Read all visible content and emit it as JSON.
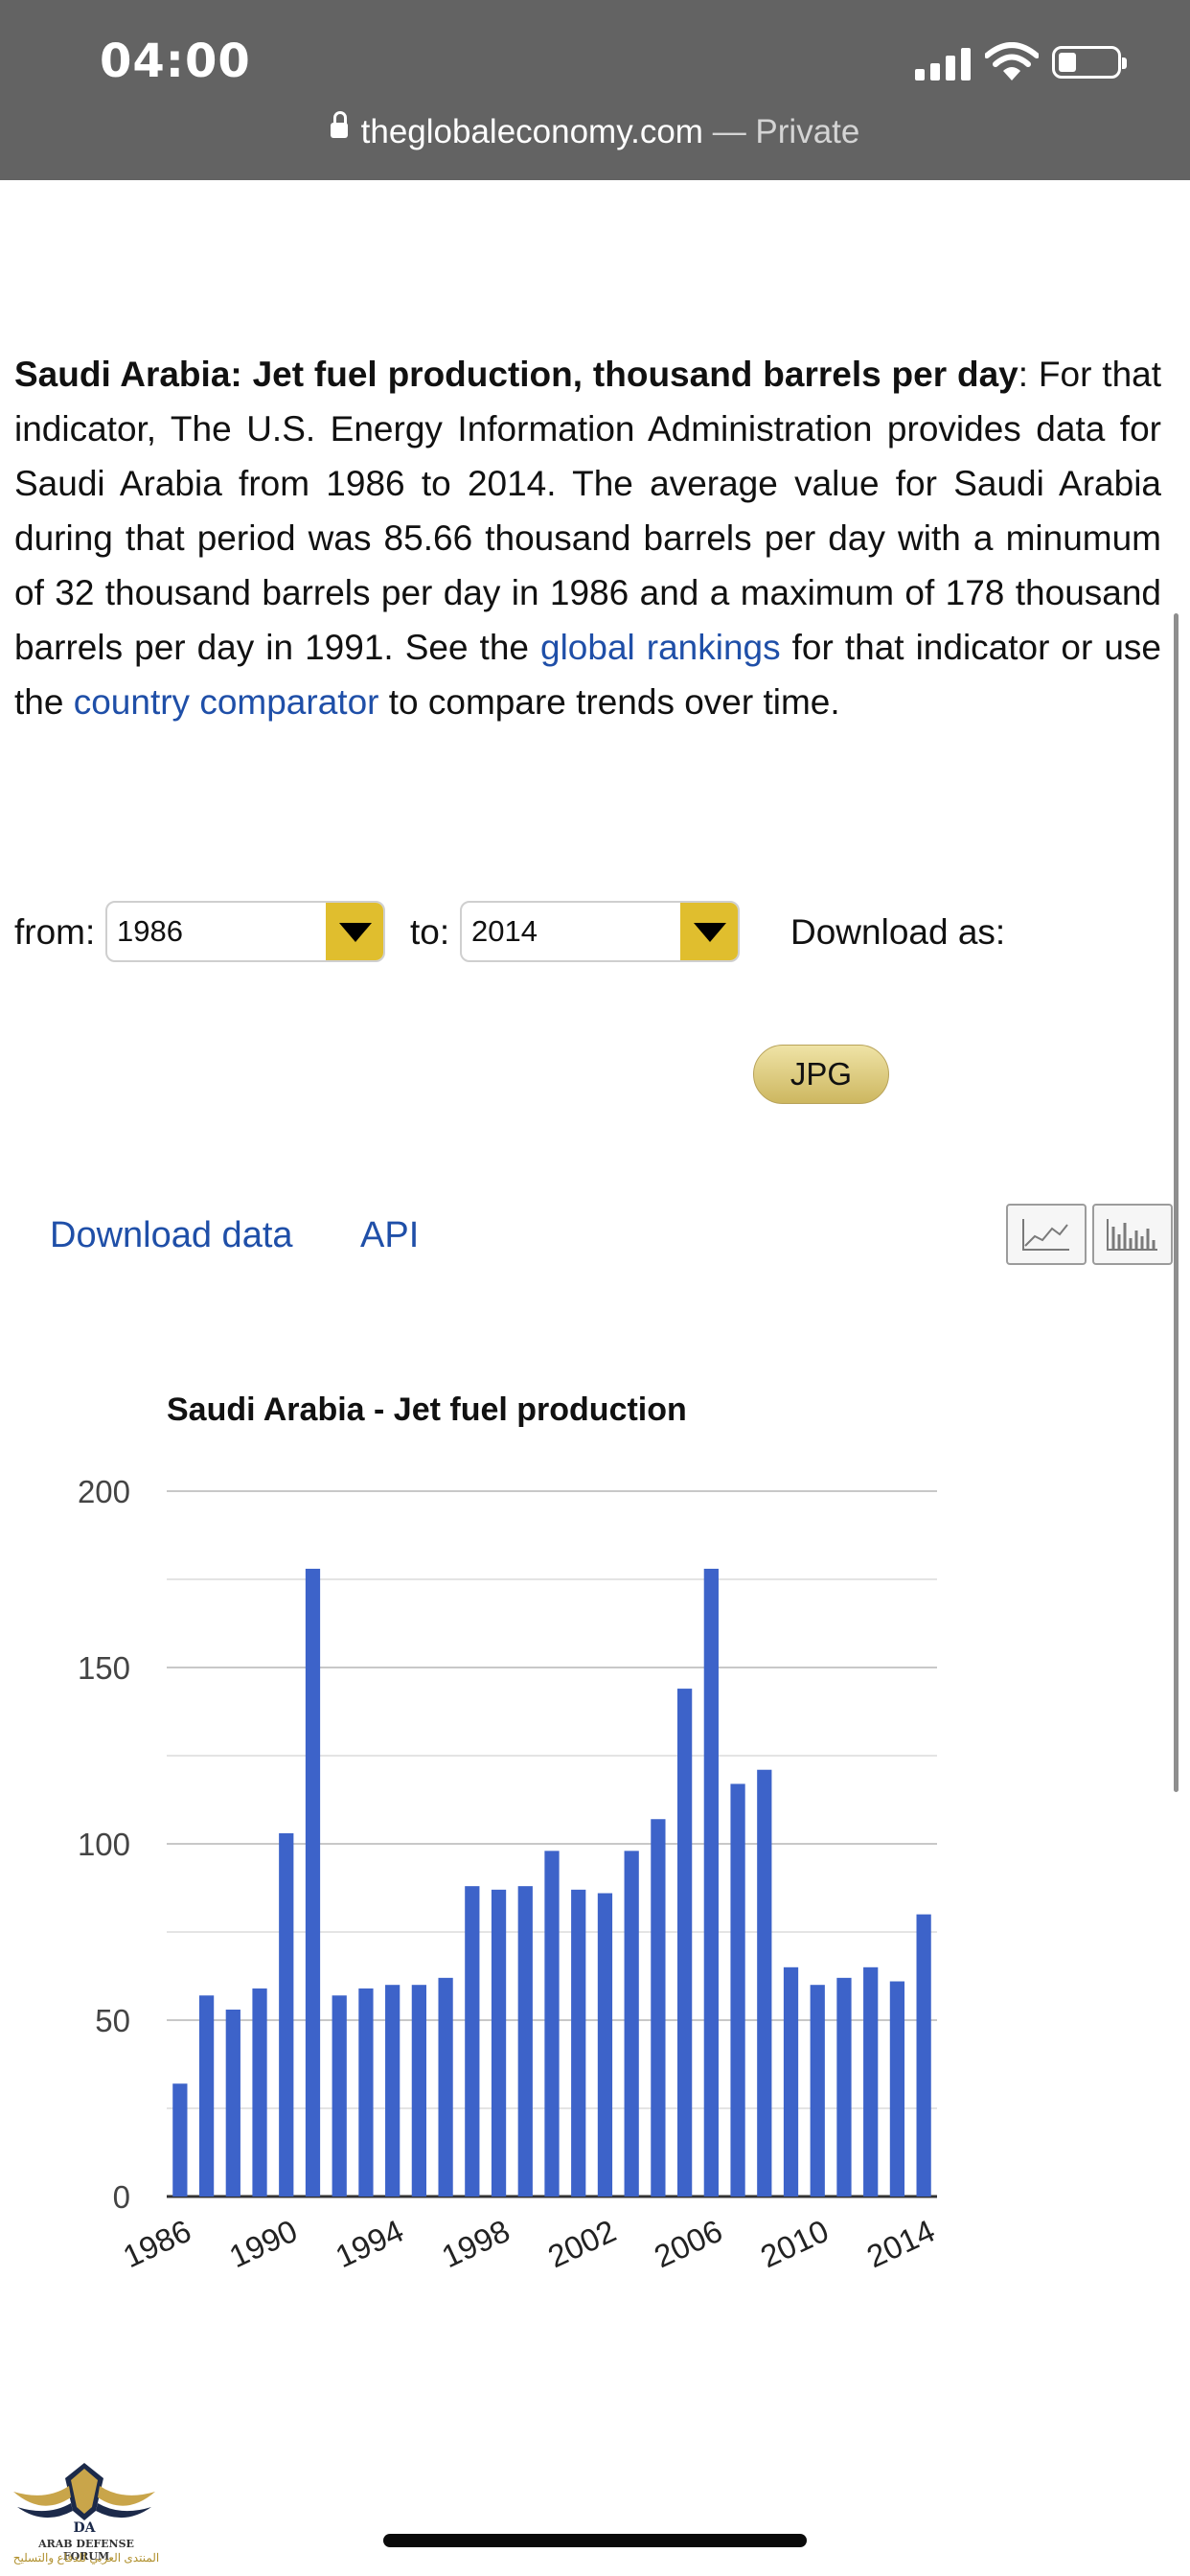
{
  "status_bar": {
    "time": "04:00"
  },
  "browser": {
    "domain": "theglobaleconomy.com",
    "separator": " — ",
    "private_label": "Private"
  },
  "article": {
    "heading": "Saudi Arabia: Jet fuel production, thousand barrels per day",
    "colon": ":",
    "body_1": " For that indicator, The U.S. Energy Information Administration provides data for Saudi Arabia from 1986 to 2014. The average value for Saudi Arabia during that period was 85.66 thousand barrels per day with a minumum of 32 thousand barrels per day in 1986 and a maximum of 178 thousand barrels per day in 1991. See the ",
    "link_rankings": "global rankings",
    "body_2": " for that indicator or use the ",
    "link_comparator": "country comparator",
    "body_3": " to compare trends over time."
  },
  "controls": {
    "from_label": "from:",
    "from_value": "1986",
    "to_label": "to:",
    "to_value": "2014",
    "download_as_label": "Download as:",
    "jpg_button": "JPG",
    "download_data_link": "Download data",
    "api_link": "API",
    "chart_type_icons": [
      "line-chart-icon",
      "bar-chart-icon"
    ]
  },
  "colors": {
    "bar": "#3d63c9",
    "link": "#1f4fa8",
    "select_button": "#e0be2e",
    "top_bar": "#636363"
  },
  "chart_data": {
    "type": "bar",
    "title": "Saudi Arabia - Jet fuel production",
    "categories": [
      "1986",
      "1987",
      "1988",
      "1989",
      "1990",
      "1991",
      "1992",
      "1993",
      "1994",
      "1995",
      "1996",
      "1997",
      "1998",
      "1999",
      "2000",
      "2001",
      "2002",
      "2003",
      "2004",
      "2005",
      "2006",
      "2007",
      "2008",
      "2009",
      "2010",
      "2011",
      "2012",
      "2013",
      "2014"
    ],
    "values": [
      32,
      57,
      53,
      59,
      103,
      178,
      57,
      59,
      60,
      60,
      62,
      88,
      87,
      88,
      98,
      87,
      86,
      98,
      107,
      144,
      178,
      117,
      121,
      65,
      60,
      62,
      65,
      61,
      80
    ],
    "x_tick_labels": [
      "1986",
      "1990",
      "1994",
      "1998",
      "2002",
      "2006",
      "2010",
      "2014"
    ],
    "y_tick_labels": [
      "0",
      "50",
      "100",
      "150",
      "200"
    ],
    "ylim": [
      0,
      200
    ],
    "y_gridlines": [
      0,
      25,
      50,
      75,
      100,
      125,
      150,
      175,
      200
    ],
    "grid": true,
    "legend": "none"
  },
  "watermark": {
    "line1": "ARAB DEFENSE FORUM",
    "line2": "المنتدى العربي للدفاع والتسليح"
  }
}
